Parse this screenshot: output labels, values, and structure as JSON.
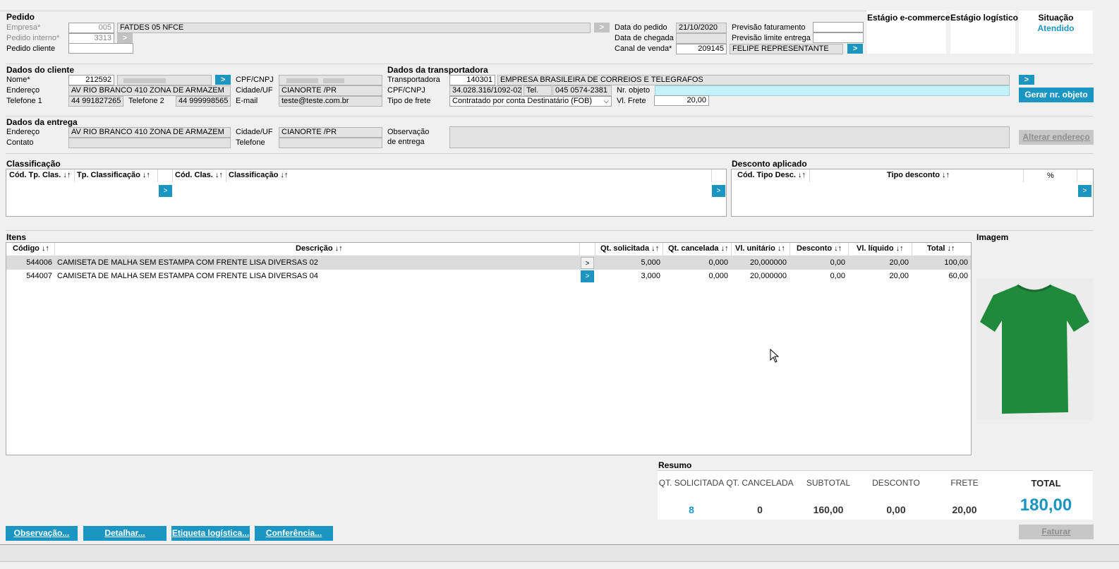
{
  "pedido": {
    "title": "Pedido",
    "empresa_label": "Empresa*",
    "empresa_code": "005",
    "empresa_name": "FATDES 05 NFCE",
    "pedido_interno_label": "Pedido interno*",
    "pedido_interno": "3313",
    "pedido_cliente_label": "Pedido cliente",
    "pedido_cliente": "",
    "data_pedido_label": "Data do pedido",
    "data_pedido": "21/10/2020",
    "data_chegada_label": "Data de chegada",
    "data_chegada": "",
    "canal_label": "Canal de venda*",
    "canal_code": "209145",
    "canal_name": "FELIPE REPRESENTANTE",
    "prev_fat_label": "Previsão faturamento",
    "prev_fat": "",
    "prev_limite_label": "Previsão limite entrega",
    "prev_limite": ""
  },
  "status": {
    "ecommerce_label": "Estágio e-commerce",
    "logistico_label": "Estágio logístico",
    "situacao_label": "Situação",
    "situacao_value": "Atendido",
    "situacao_color": "#1a95c0"
  },
  "cliente": {
    "title": "Dados do cliente",
    "nome_label": "Nome*",
    "nome_code": "212592",
    "cpf_label": "CPF/CNPJ",
    "endereco_label": "Endereço",
    "endereco": "AV RIO BRANCO 410  ZONA DE ARMAZEM",
    "cidade_label": "Cidade/UF",
    "cidade": "CIANORTE /PR",
    "telefone1_label": "Telefone 1",
    "telefone1": "44 991827265",
    "telefone2_label": "Telefone 2",
    "telefone2": "44 999998565",
    "email_label": "E-mail",
    "email": "teste@teste.com.br"
  },
  "transportadora": {
    "title": "Dados da transportadora",
    "transp_label": "Transportadora",
    "transp_code": "140301",
    "transp_name": "EMPRESA BRASILEIRA DE CORREIOS E TELEGRAFOS",
    "cpf_label": "CPF/CNPJ",
    "cpf": "34.028.316/1092-02",
    "tel_label": "Tel.",
    "tel": "045 0574-2381",
    "nr_objeto_label": "Nr. objeto",
    "nr_objeto": "",
    "tipo_frete_label": "Tipo de frete",
    "tipo_frete": "Contratado por conta Destinatário (FOB)",
    "vl_frete_label": "Vl. Frete",
    "vl_frete": "20,00",
    "gerar_btn": "Gerar nr. objeto"
  },
  "entrega": {
    "title": "Dados da entrega",
    "endereco_label": "Endereço",
    "endereco": "AV RIO BRANCO 410  ZONA DE ARMAZEM",
    "contato_label": "Contato",
    "contato": "",
    "cidade_label": "Cidade/UF",
    "cidade": "CIANORTE /PR",
    "telefone_label": "Telefone",
    "telefone": "",
    "obs_label_1": "Observação",
    "obs_label_2": "de entrega",
    "obs": "",
    "alterar_btn": "Alterar endereço"
  },
  "classificacao": {
    "title": "Classificação",
    "col1": "Cód. Tp. Clas. ↓↑",
    "col2": "Tp. Classificação ↓↑",
    "col3": "Cód. Clas. ↓↑",
    "col4": "Classificação ↓↑"
  },
  "desconto": {
    "title": "Desconto aplicado",
    "col1": "Cód. Tipo Desc. ↓↑",
    "col2": "Tipo desconto ↓↑",
    "col3": "%"
  },
  "itens": {
    "title": "Itens",
    "columns": [
      "Código ↓↑",
      "Descrição ↓↑",
      "Qt. solicitada ↓↑",
      "Qt. cancelada ↓↑",
      "Vl. unitário ↓↑",
      "Desconto ↓↑",
      "Vl. líquido ↓↑",
      "Total ↓↑"
    ],
    "rows": [
      {
        "codigo": "544006",
        "descricao": "CAMISETA DE MALHA SEM ESTAMPA COM FRENTE LISA DIVERSAS 02",
        "qt_sol": "5,000",
        "qt_canc": "0,000",
        "vl_unit": "20,000000",
        "desconto": "0,00",
        "vl_liq": "20,00",
        "total": "100,00"
      },
      {
        "codigo": "544007",
        "descricao": "CAMISETA DE MALHA SEM ESTAMPA COM FRENTE LISA DIVERSAS 04",
        "qt_sol": "3,000",
        "qt_canc": "0,000",
        "vl_unit": "20,000000",
        "desconto": "0,00",
        "vl_liq": "20,00",
        "total": "60,00"
      }
    ]
  },
  "imagem": {
    "title": "Imagem",
    "shirt_color": "#1f8a3c"
  },
  "resumo": {
    "title": "Resumo",
    "qt_sol_label": "QT. SOLICITADA",
    "qt_sol": "8",
    "qt_canc_label": "QT. CANCELADA",
    "qt_canc": "0",
    "subtotal_label": "SUBTOTAL",
    "subtotal": "160,00",
    "desconto_label": "DESCONTO",
    "desconto": "0,00",
    "frete_label": "FRETE",
    "frete": "20,00",
    "total_label": "TOTAL",
    "total": "180,00"
  },
  "buttons": {
    "observacao": "Observação...",
    "detalhar": "Detalhar...",
    "etiqueta": "Etiqueta logística...",
    "conferencia": "Conferência...",
    "faturar": "Faturar",
    "go": ">"
  }
}
